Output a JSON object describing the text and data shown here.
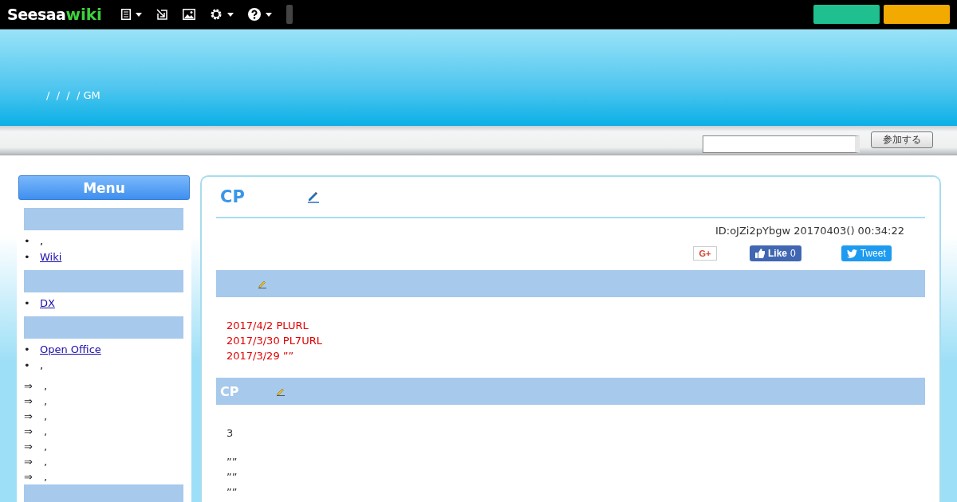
{
  "topbar": {
    "logo": {
      "brand": "Seesaa",
      "suffix": "wiki"
    }
  },
  "header": {
    "breadcrumb": "/  /  /  / GM"
  },
  "toolbar": {
    "join_button": "参加する"
  },
  "sidebar": {
    "title": "Menu",
    "sections": [
      {
        "kind": "group",
        "items": [
          {
            "kind": "bullet",
            "marker": "•",
            "text": ",",
            "link": false
          },
          {
            "kind": "bullet",
            "marker": "•",
            "text": "Wiki",
            "link": true
          }
        ]
      },
      {
        "kind": "group",
        "items": [
          {
            "kind": "bullet",
            "marker": "•",
            "text": "DX",
            "link": true
          }
        ]
      },
      {
        "kind": "group",
        "items": [
          {
            "kind": "bullet",
            "marker": "•",
            "text": "Open Office",
            "link": true
          },
          {
            "kind": "bullet",
            "marker": "•",
            "text": ",",
            "link": false
          },
          {
            "kind": "arrow",
            "arrow": "⇒",
            "text": ","
          },
          {
            "kind": "arrow",
            "arrow": "⇒",
            "text": ","
          },
          {
            "kind": "arrow",
            "arrow": "⇒",
            "text": ","
          },
          {
            "kind": "arrow",
            "arrow": "⇒",
            "text": ","
          },
          {
            "kind": "arrow",
            "arrow": "⇒",
            "text": ","
          },
          {
            "kind": "arrow",
            "arrow": "⇒",
            "text": ","
          },
          {
            "kind": "arrow",
            "arrow": "⇒",
            "text": ","
          }
        ]
      },
      {
        "kind": "header_only"
      }
    ]
  },
  "article": {
    "title": "CP",
    "meta": "ID:oJZi2pYbgw 20170403() 00:34:22",
    "share": {
      "gplus": "G+",
      "like": "Like",
      "like_count": "0",
      "tweet": "Tweet"
    },
    "sections": [
      {
        "lines": [
          {
            "kind": "notice",
            "text": "2017/4/2 PLURL"
          },
          {
            "kind": "notice",
            "text": "2017/3/30 PL7URL"
          },
          {
            "kind": "notice",
            "text": "2017/3/29 ””"
          }
        ]
      },
      {
        "heading": "CP",
        "lines": [
          {
            "kind": "para",
            "text": "3"
          },
          {
            "kind": "gap"
          },
          {
            "kind": "quote",
            "text": "””"
          },
          {
            "kind": "quote",
            "text": "””"
          },
          {
            "kind": "quote",
            "text": "””"
          }
        ]
      }
    ]
  }
}
